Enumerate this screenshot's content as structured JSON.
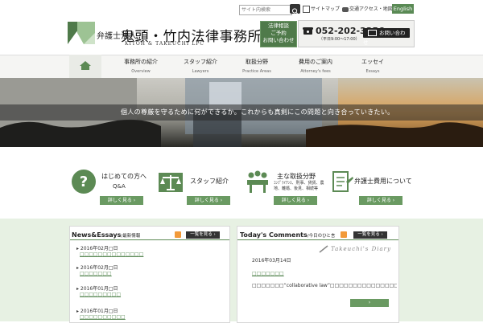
{
  "header": {
    "logo_small": "弁護士法人",
    "logo_big": "鬼頭・竹内法律事務所",
    "logo_sub": "KITOH & TAKEUCHI LPC",
    "search_placeholder": "サイト内検索",
    "sitemap": "サイトマップ",
    "access": "交通アクセス・地図",
    "english": "English",
    "consult_line1": "法律相談",
    "consult_line2": "ご予約",
    "consult_line3": "お問い合わせ",
    "phone": "052-202-3356",
    "hours": "（平日9:00～17:00）",
    "mail": "お問い合わせ"
  },
  "nav": [
    {
      "jp": "事務所の紹介",
      "en": "Overview"
    },
    {
      "jp": "スタッフ紹介",
      "en": "Lawyers"
    },
    {
      "jp": "取扱分野",
      "en": "Practice Areas"
    },
    {
      "jp": "費用のご案内",
      "en": "Attorney's fees"
    },
    {
      "jp": "エッセイ",
      "en": "Essays"
    }
  ],
  "hero": {
    "text": "個人の尊厳を守るために何ができるか。これからも真剣にこの問題と向き合っていきたい。"
  },
  "features": [
    {
      "title": "はじめての方へ",
      "sub": "Q&A",
      "btn": "詳しく見る"
    },
    {
      "title": "スタッフ紹介",
      "sub": "",
      "btn": "詳しく見る"
    },
    {
      "title": "主な取扱分野",
      "sub": "ｺﾝﾌﾟﾗｲｱﾝｽ、刑事、貸貨、農地、離婚、後見、相続等",
      "btn": "詳しく見る"
    },
    {
      "title": "弁護士費用について",
      "sub": "",
      "btn": "詳しく見る"
    }
  ],
  "news": {
    "title": "News&Essays",
    "subtitle": "/最新情報",
    "list_btn": "一覧を見る",
    "items": [
      {
        "date": "2016年02月□日",
        "link": "□□□□□□□□□□□□□□"
      },
      {
        "date": "2016年02月□日",
        "link": "□□□□□□□"
      },
      {
        "date": "2016年01月□日",
        "link": "□□□□□□□□□"
      },
      {
        "date": "2016年01月□日",
        "link": "□□□□□□□□□□"
      }
    ]
  },
  "comments": {
    "title": "Today's Comments",
    "subtitle": "/今日のひと言",
    "list_btn": "一覧を見る",
    "diary": "Takeuchi's Diary",
    "date": "2016年03月14日",
    "link": "□□□□□□□",
    "text": "□□□□□□□“collaborative law”□□□□□□□□□□□□□□□□□□□□□□□□□□□□□□□□□□□□□□□□□□□ □□□"
  }
}
